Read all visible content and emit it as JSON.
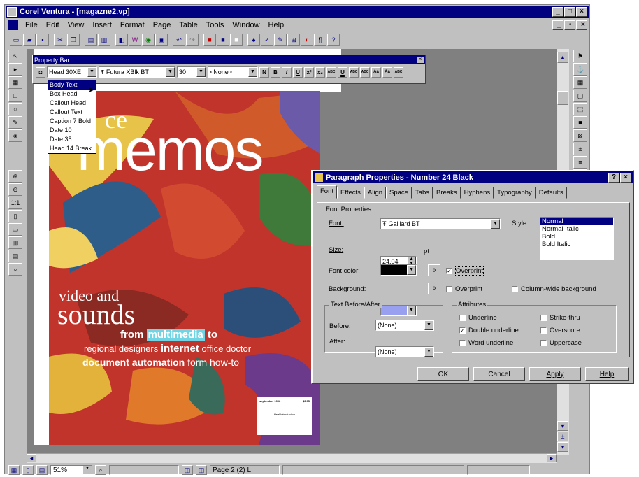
{
  "window": {
    "title": "Corel Ventura - [magazne2.vp]"
  },
  "menu": [
    "File",
    "Edit",
    "View",
    "Insert",
    "Format",
    "Page",
    "Table",
    "Tools",
    "Window",
    "Help"
  ],
  "property_bar": {
    "title": "Property Bar",
    "tag": "Head 30XE",
    "font": "Futura XBlk BT",
    "size": "30",
    "none": "<None>",
    "format_buttons": [
      "N",
      "B",
      "I",
      "U",
      "x²",
      "x₂",
      "ABC",
      "U",
      "ABC",
      "ABC",
      "Aa",
      "Aa",
      "ABC"
    ]
  },
  "tag_list": {
    "items": [
      "Body Text",
      "Box Head",
      "Callout Head",
      "Callout Text",
      "Caption 7 Bold",
      "Date 10",
      "Date 35",
      "Head 14 Break"
    ],
    "selected": 0
  },
  "magazine": {
    "small_word": "ce",
    "big_word": "memos",
    "video_and": "video and",
    "sounds": "sounds",
    "line1_a": "from",
    "line1_b": "multimedia",
    "line1_c": "to",
    "line2_a": "regional designers",
    "line2_b": "internet",
    "line2_c": "office doctor",
    "line3_a": "document automation",
    "line3_b": "form how-to",
    "label_date": "september 1996",
    "label_price": "$3.95",
    "label_text": "Heal Introduction"
  },
  "dialog": {
    "title": "Paragraph Properties - Number 24 Black",
    "tabs": [
      "Font",
      "Effects",
      "Align",
      "Space",
      "Tabs",
      "Breaks",
      "Hyphens",
      "Typography",
      "Defaults"
    ],
    "active_tab": "Font",
    "font_properties": "Font Properties",
    "font_label": "Font:",
    "font_value": "Galliard BT",
    "style_label": "Style:",
    "styles": [
      "Normal",
      "Normal Italic",
      "Bold",
      "Bold Italic"
    ],
    "size_label": "Size:",
    "size_value": "24.04",
    "size_unit": "pt",
    "font_color_label": "Font color:",
    "overprint_label": "Overprint",
    "background_label": "Background:",
    "overprint2_label": "Overprint",
    "column_bg_label": "Column-wide background",
    "text_before_after": "Text Before/After",
    "before_label": "Before:",
    "before_value": "(None)",
    "after_label": "After:",
    "after_value": "(None)",
    "attributes": "Attributes",
    "attr_left": [
      "Underline",
      "Double underline",
      "Word underline"
    ],
    "attr_left_checked": [
      false,
      true,
      false
    ],
    "attr_right": [
      "Strike-thru",
      "Overscore",
      "Uppercase"
    ],
    "buttons": [
      "OK",
      "Cancel",
      "Apply",
      "Help"
    ]
  },
  "status": {
    "zoom": "51%",
    "page": "Page 2 (2)  L"
  },
  "colors": {
    "title": "#000080",
    "chrome": "#c0c0c0",
    "highlight": "#6fd4e4",
    "page_red": "#c0342b",
    "bg_swatch": "#9aa0f0"
  }
}
